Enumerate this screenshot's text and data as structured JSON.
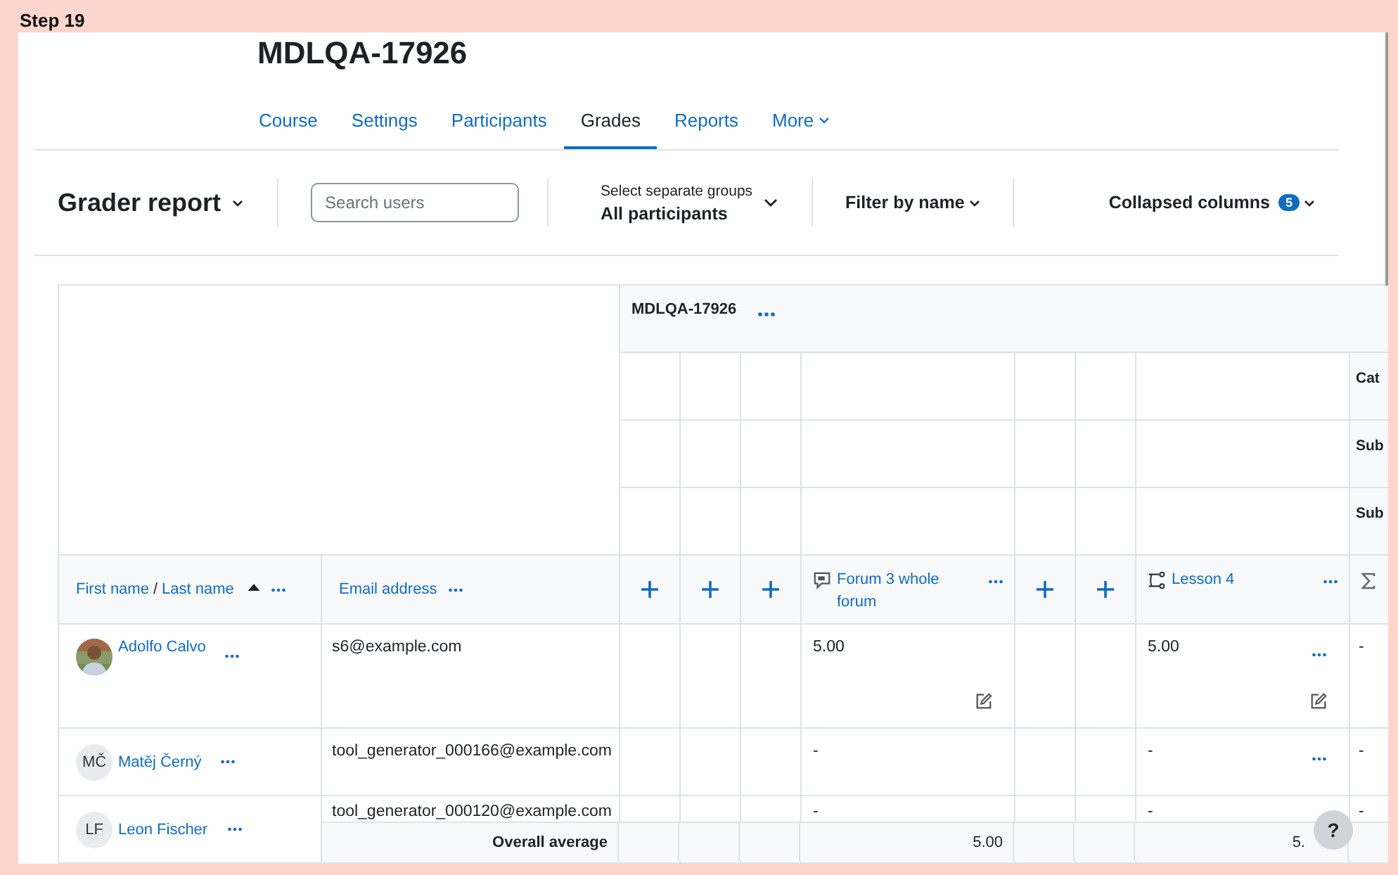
{
  "page_label": "Step 19",
  "course_title": "MDLQA-17926",
  "nav_tabs": [
    {
      "label": "Course",
      "selected": false,
      "menu": false
    },
    {
      "label": "Settings",
      "selected": false,
      "menu": false
    },
    {
      "label": "Participants",
      "selected": false,
      "menu": false
    },
    {
      "label": "Grades",
      "selected": true,
      "menu": false
    },
    {
      "label": "Reports",
      "selected": false,
      "menu": false
    },
    {
      "label": "More",
      "selected": false,
      "menu": true
    }
  ],
  "toolbar": {
    "report": "Grader report",
    "search": {
      "placeholder": "Search users"
    },
    "group": {
      "label": "Select separate groups",
      "value": "All participants"
    },
    "filter": "Filter by name",
    "collapsed": {
      "label": "Collapsed columns",
      "count": "5"
    }
  },
  "grader_table": {
    "category": "MDLQA-17926",
    "category_rows": [
      "Cat",
      "Sub",
      "Sub"
    ],
    "name_header": {
      "first": "First name",
      "separator": "/",
      "last": "Last name"
    },
    "email_header": "Email address",
    "columns": [
      {
        "kind": "collapsed"
      },
      {
        "kind": "collapsed"
      },
      {
        "kind": "collapsed"
      },
      {
        "kind": "forum",
        "name": "Forum 3 whole forum"
      },
      {
        "kind": "collapsed"
      },
      {
        "kind": "collapsed"
      },
      {
        "kind": "lesson",
        "name": "Lesson 4"
      },
      {
        "kind": "total"
      }
    ],
    "rows": [
      {
        "name": "Adolfo Calvo",
        "email": "s6@example.com",
        "grades": [
          {
            "value": "5.00",
            "menu": false,
            "edit": true
          },
          {
            "value": "5.00",
            "menu": true,
            "edit": true
          },
          {
            "value": "-",
            "menu": false,
            "edit": false
          }
        ]
      },
      {
        "name": "Matěj Černý",
        "avatar": {
          "kind": "initials",
          "text": "MČ"
        },
        "email": "tool_generator_000166@example.com",
        "grades": [
          {
            "value": "-",
            "menu": false,
            "edit": false
          },
          {
            "value": "-",
            "menu": true,
            "edit": false
          },
          {
            "value": "-",
            "menu": false,
            "edit": false
          }
        ]
      },
      {
        "name": "Leon Fischer",
        "avatar": {
          "kind": "initials",
          "text": "LF"
        },
        "email": "tool_generator_000120@example.com",
        "grades": [
          {
            "value": "-"
          },
          {
            "value": "-"
          },
          {
            "value": "-"
          }
        ]
      }
    ],
    "footer": {
      "label": "Overall average",
      "values": [
        "5.00",
        "5."
      ]
    }
  },
  "help": "?"
}
